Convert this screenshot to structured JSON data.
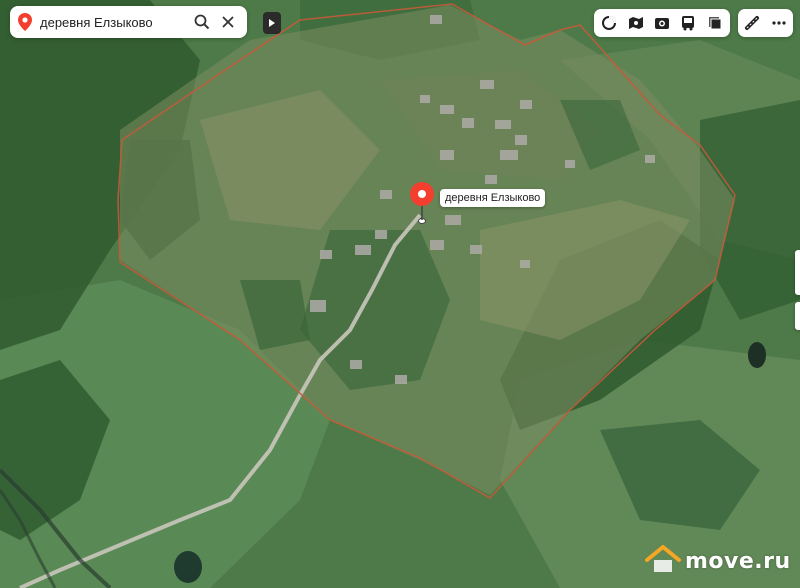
{
  "search": {
    "query": "деревня Елзыково"
  },
  "marker": {
    "label": "деревня Елзыково",
    "color": "#f43f2f"
  },
  "toolbar": {
    "buttons": [
      "traffic-icon",
      "panorama-icon",
      "metro-icon",
      "transport-icon",
      "layers-icon"
    ],
    "extra_buttons": [
      "ruler-icon",
      "more-icon"
    ]
  },
  "boundary": {
    "color": "#c65a3a"
  },
  "watermark": {
    "text": "move.ru"
  }
}
